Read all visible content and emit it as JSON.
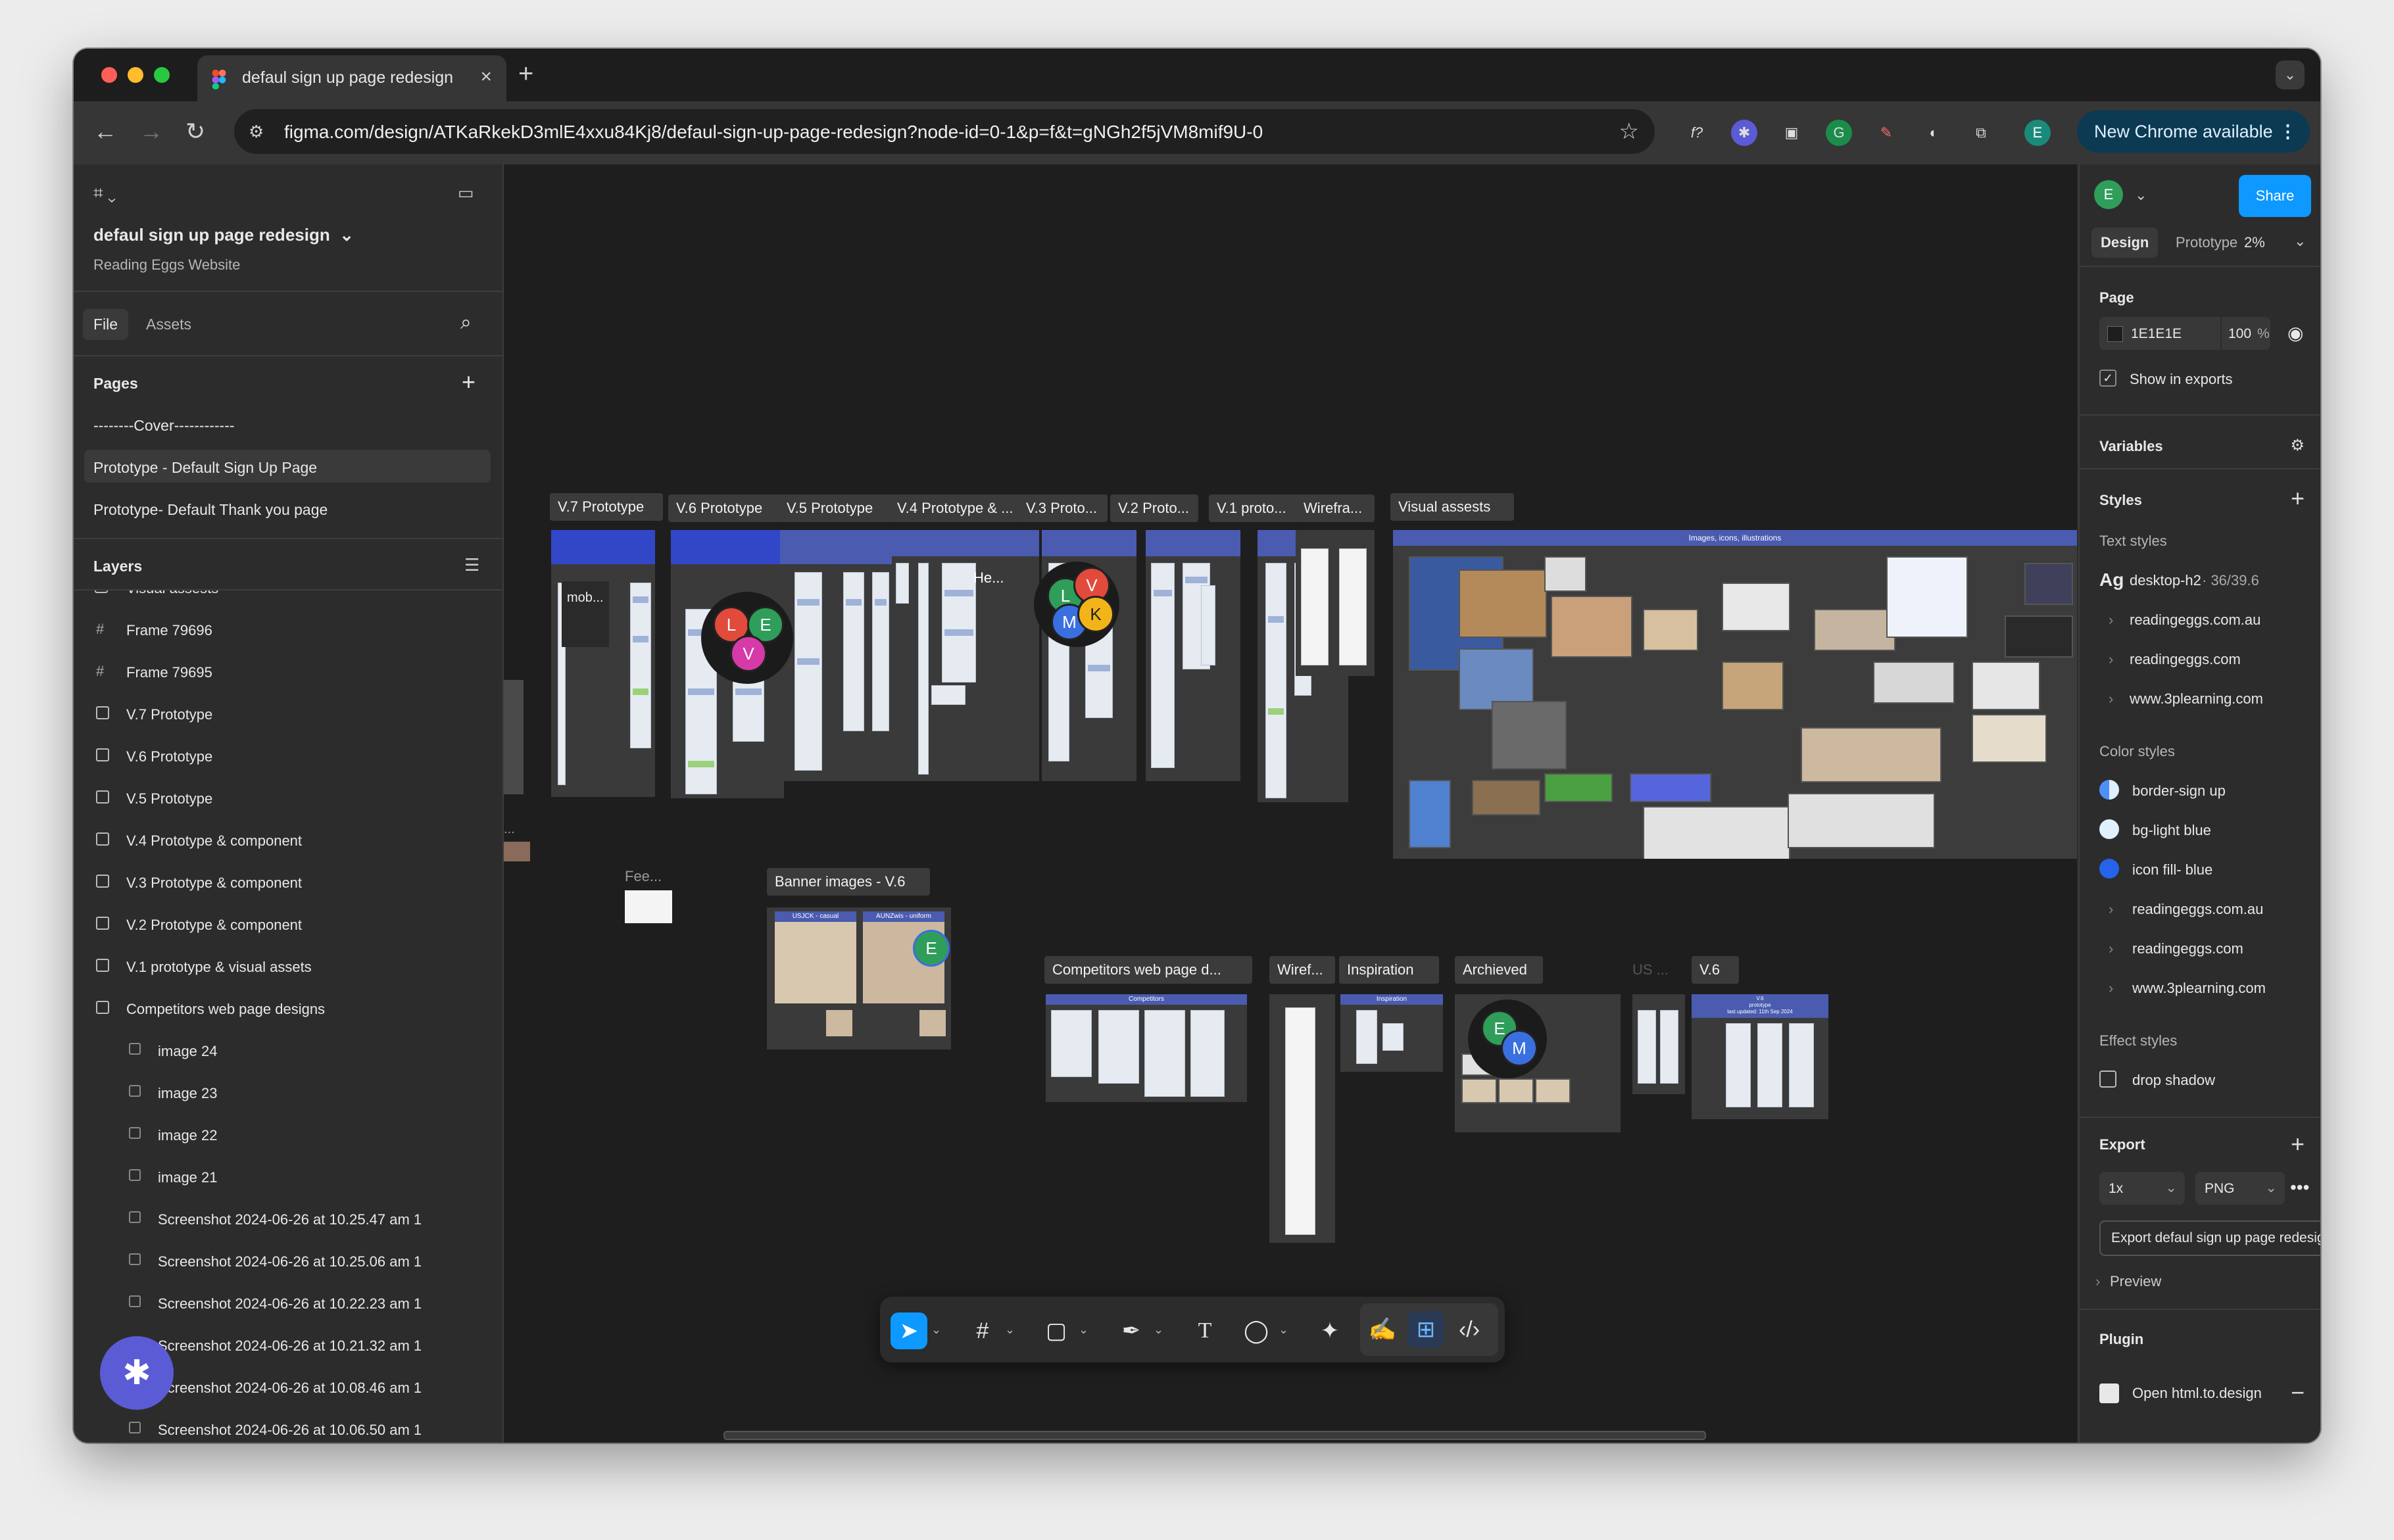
{
  "browser": {
    "tab_title": "defaul sign up page redesign",
    "url": "figma.com/design/ATKaRkekD3mlE4xxu84Kj8/defaul-sign-up-page-redesign?node-id=0-1&p=f&t=gNGh2f5jVM8mif9U-0",
    "profile_initial": "E",
    "update_label": "New Chrome available"
  },
  "left_panel": {
    "file_name": "defaul sign up page redesign",
    "project_name": "Reading Eggs Website",
    "tabs": [
      "File",
      "Assets"
    ],
    "pages_title": "Pages",
    "pages": [
      "--------Cover------------",
      "Prototype - Default Sign Up Page",
      "Prototype- Default Thank you page"
    ],
    "layers_title": "Layers",
    "layers_partial": "Visual assests",
    "layers": [
      {
        "name": "Frame 79696",
        "type": "frame"
      },
      {
        "name": "Frame 79695",
        "type": "frame"
      },
      {
        "name": "V.7 Prototype",
        "type": "section"
      },
      {
        "name": "V.6 Prototype",
        "type": "section"
      },
      {
        "name": "V.5 Prototype",
        "type": "section"
      },
      {
        "name": "V.4 Prototype & component",
        "type": "section"
      },
      {
        "name": "V.3 Prototype & component",
        "type": "section"
      },
      {
        "name": "V.2 Prototype & component",
        "type": "section"
      },
      {
        "name": "V.1 prototype & visual assets",
        "type": "section"
      },
      {
        "name": "Competitors web page designs",
        "type": "section"
      },
      {
        "name": "image 24",
        "type": "image"
      },
      {
        "name": "image 23",
        "type": "image"
      },
      {
        "name": "image 22",
        "type": "image"
      },
      {
        "name": "image 21",
        "type": "image"
      },
      {
        "name": "Screenshot 2024-06-26 at 10.25.47 am 1",
        "type": "image"
      },
      {
        "name": "Screenshot 2024-06-26 at 10.25.06 am 1",
        "type": "image"
      },
      {
        "name": "Screenshot 2024-06-26 at 10.22.23 am 1",
        "type": "image"
      },
      {
        "name": "Screenshot 2024-06-26 at 10.21.32 am 1",
        "type": "image"
      },
      {
        "name": "Screenshot 2024-06-26 at 10.08.46 am 1",
        "type": "image"
      },
      {
        "name": "Screenshot 2024-06-26 at 10.06.50 am 1",
        "type": "image"
      }
    ]
  },
  "canvas": {
    "labels": {
      "v7": "V.7 Prototype",
      "v6": "V.6 Prototype",
      "v5": "V.5 Prototype",
      "v4": "V.4 Prototype & ...",
      "v3": "V.3 Proto...",
      "v2": "V.2 Proto...",
      "v1": "V.1 proto...",
      "wireframes": "Wirefra...",
      "visual": "Visual assests",
      "banner": "Banner images - V.6",
      "competitors": "Competitors web page d...",
      "wiref2": "Wiref...",
      "inspiration": "Inspiration",
      "archieved": "Archieved",
      "us": "US ...",
      "v6b": "V.6",
      "feedback": "Fee...",
      "mob": "mob...",
      "he": "He..."
    },
    "avatars": {
      "c1": [
        "L",
        "E",
        "V"
      ],
      "c2": [
        "L",
        "V",
        "M",
        "K"
      ],
      "banner": "E",
      "archieved": [
        "E",
        "M"
      ]
    },
    "frame_captions": {
      "visual": "Images, icons, illustrations",
      "competitors": "Competitors",
      "inspiration": "Inspiration",
      "banner_a": "USJCK - casual",
      "banner_b": "AUNZwis - uniform",
      "v6b_line1": "V.6",
      "v6b_line2": "prototype",
      "v6b_line3": "last updated: 11th Sep 2024"
    }
  },
  "right_panel": {
    "user_initial": "E",
    "share_label": "Share",
    "tabs": [
      "Design",
      "Prototype"
    ],
    "zoom": "2%",
    "page_title": "Page",
    "page_color": "1E1E1E",
    "page_opacity": "100",
    "percent_sign": "%",
    "show_in_exports": "Show in exports",
    "variables_title": "Variables",
    "styles_title": "Styles",
    "text_styles_title": "Text styles",
    "text_style_sample": "Ag",
    "text_style_name": "desktop-h2",
    "text_style_meta": "· 36/39.6",
    "text_style_groups": [
      "readingeggs.com.au",
      "readingeggs.com",
      "www.3plearning.com"
    ],
    "color_styles_title": "Color styles",
    "color_styles": [
      {
        "name": "border-sign up",
        "color": "#4f8ff7"
      },
      {
        "name": "bg-light blue",
        "color": "#dff0ff"
      },
      {
        "name": "icon fill- blue",
        "color": "#2563eb"
      }
    ],
    "color_style_groups": [
      "readingeggs.com.au",
      "readingeggs.com",
      "www.3plearning.com"
    ],
    "effect_styles_title": "Effect styles",
    "effect_style": "drop shadow",
    "export_title": "Export",
    "export_scale": "1x",
    "export_format": "PNG",
    "export_button": "Export defaul sign up page redesign",
    "preview_label": "Preview",
    "plugin_title": "Plugin",
    "plugin_item": "Open html.to.design",
    "help": "?"
  },
  "colors": {
    "figma_blue": "#0d99ff",
    "canvas_bg": "#1e1e1e",
    "panel_bg": "#2c2c2c",
    "prototype_header_blue": "#3147c8"
  }
}
